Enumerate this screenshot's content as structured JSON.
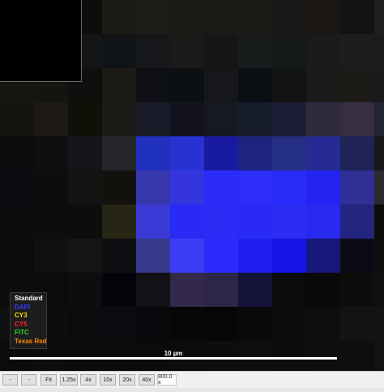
{
  "viewer": {
    "pixel_colors": [
      [
        "#050505",
        "#0a0a08",
        "#0d0d0b",
        "#1d1b17",
        "#1c1c18",
        "#1c1a14",
        "#1a1a17",
        "#1b1a15",
        "#1a1816",
        "#191613",
        "#131311",
        "#201f23"
      ],
      [
        "#050505",
        "#0b0c0e",
        "#131516",
        "#101416",
        "#15171a",
        "#1a1b19",
        "#151716",
        "#171b1a",
        "#151818",
        "#191a1c",
        "#1c1e1e",
        "#1c1b20"
      ],
      [
        "#161512",
        "#141511",
        "#0f100d",
        "#1c1a16",
        "#0f1015",
        "#0d1013",
        "#15171a",
        "#0b0e13",
        "#121314",
        "#1c1a1a",
        "#1d1b18",
        "#1b1a1d"
      ],
      [
        "#16140f",
        "#1d1a16",
        "#101009",
        "#1d1b17",
        "#1a1b29",
        "#12131f",
        "#161923",
        "#171c2b",
        "#1b1b35",
        "#2e2b3d",
        "#372f3f",
        "#242331"
      ],
      [
        "#0c0c0f",
        "#0f0f10",
        "#141518",
        "#26262a",
        "#2131bf",
        "#2832d2",
        "#181ba2",
        "#1c247e",
        "#253085",
        "#262b93",
        "#202355",
        "#18181c"
      ],
      [
        "#0d0c10",
        "#0d0d0e",
        "#141311",
        "#12110e",
        "#3737ac",
        "#3535df",
        "#2b2bfa",
        "#2c2df8",
        "#292bf9",
        "#2523f1",
        "#2f2f95",
        "#2a2b2e"
      ],
      [
        "#0c0c0e",
        "#0e0d0d",
        "#0d0d0e",
        "#272614",
        "#3a3ad6",
        "#2a2af7",
        "#2b2bf5",
        "#2a2af6",
        "#2c2cf2",
        "#2929f0",
        "#24257f",
        "#0c0c0a"
      ],
      [
        "#0c0c0f",
        "#101012",
        "#151515",
        "#0e0f12",
        "#353a8c",
        "#3c3cf7",
        "#2b2bfc",
        "#1f20ef",
        "#1616e8",
        "#171879",
        "#0b0b16",
        "#0f100e"
      ],
      [
        "#0c0d0e",
        "#0b0b0b",
        "#0d0d0f",
        "#04040a",
        "#121216",
        "#332a4b",
        "#2c2648",
        "#14133a",
        "#0b0b0b",
        "#0a0a0a",
        "#0d0d0b",
        "#111010"
      ],
      [
        "#101010",
        "#0e0d0c",
        "#0a0b0c",
        "#0a0b0f",
        "#090a0e",
        "#070707",
        "#060606",
        "#090909",
        "#0d0d0f",
        "#0e0e10",
        "#141414",
        "#141313"
      ],
      [
        "#0b0b0b",
        "#0c0c0c",
        "#0b0b0b",
        "#0b0b0b",
        "#0b0b0b",
        "#0c0c0c",
        "#0d0d0d",
        "#0e0e0e",
        "#0d0d0d",
        "#0e0e0e",
        "#0e0e0e",
        "#121212"
      ]
    ]
  },
  "legend": {
    "items": [
      {
        "label": "Standard",
        "color": "#ffffff"
      },
      {
        "label": "DAPI",
        "color": "#3a3aff"
      },
      {
        "label": "CY3",
        "color": "#ffd800"
      },
      {
        "label": "CY5",
        "color": "#ff2020"
      },
      {
        "label": "FITC",
        "color": "#22dd22"
      },
      {
        "label": "Texas Red",
        "color": "#ff8c00"
      }
    ]
  },
  "scalebar": {
    "label": "10 µm"
  },
  "toolbar": {
    "buttons": [
      "-",
      "-",
      "Fit",
      "1.25x",
      "4x",
      "10x",
      "20x",
      "40x"
    ],
    "zoom_readout": "800.0 x"
  }
}
